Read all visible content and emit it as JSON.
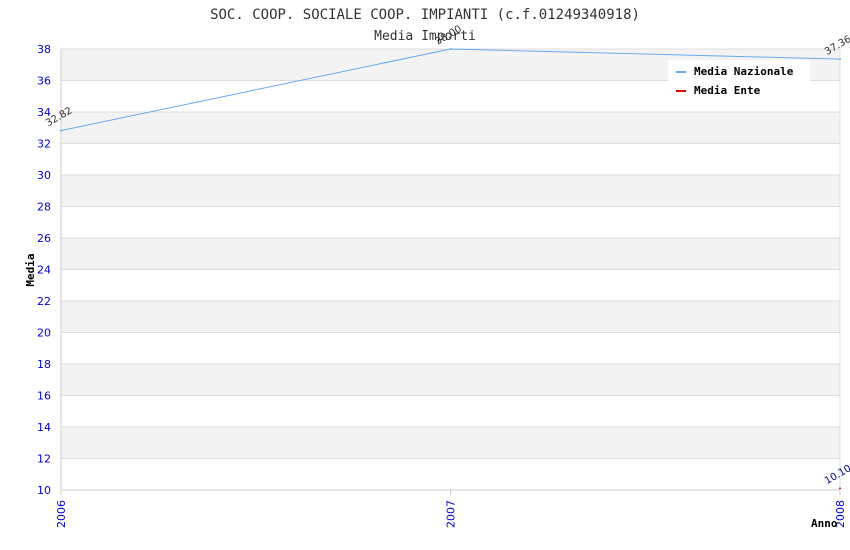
{
  "chart_data": {
    "type": "line",
    "title": "SOC. COOP. SOCIALE COOP. IMPIANTI (c.f.01249340918)",
    "subtitle": "Media Importi",
    "xlabel": "Anno",
    "ylabel": "Media",
    "categories": [
      "2006",
      "2007",
      "2008"
    ],
    "ylim": [
      10,
      38
    ],
    "yticks": [
      10,
      12,
      14,
      16,
      18,
      20,
      22,
      24,
      26,
      28,
      30,
      32,
      34,
      36,
      38
    ],
    "grid": true,
    "legend_position": "top-right",
    "series": [
      {
        "name": "Media Nazionale",
        "color": "#66aaee",
        "values": [
          32.82,
          38.0,
          37.36
        ],
        "labels": [
          "32.82",
          "38.00",
          "37.36"
        ]
      },
      {
        "name": "Media Ente",
        "color": "#dd0000",
        "values": [
          null,
          null,
          10.1
        ],
        "labels": [
          "",
          "",
          "10.10"
        ]
      }
    ]
  }
}
